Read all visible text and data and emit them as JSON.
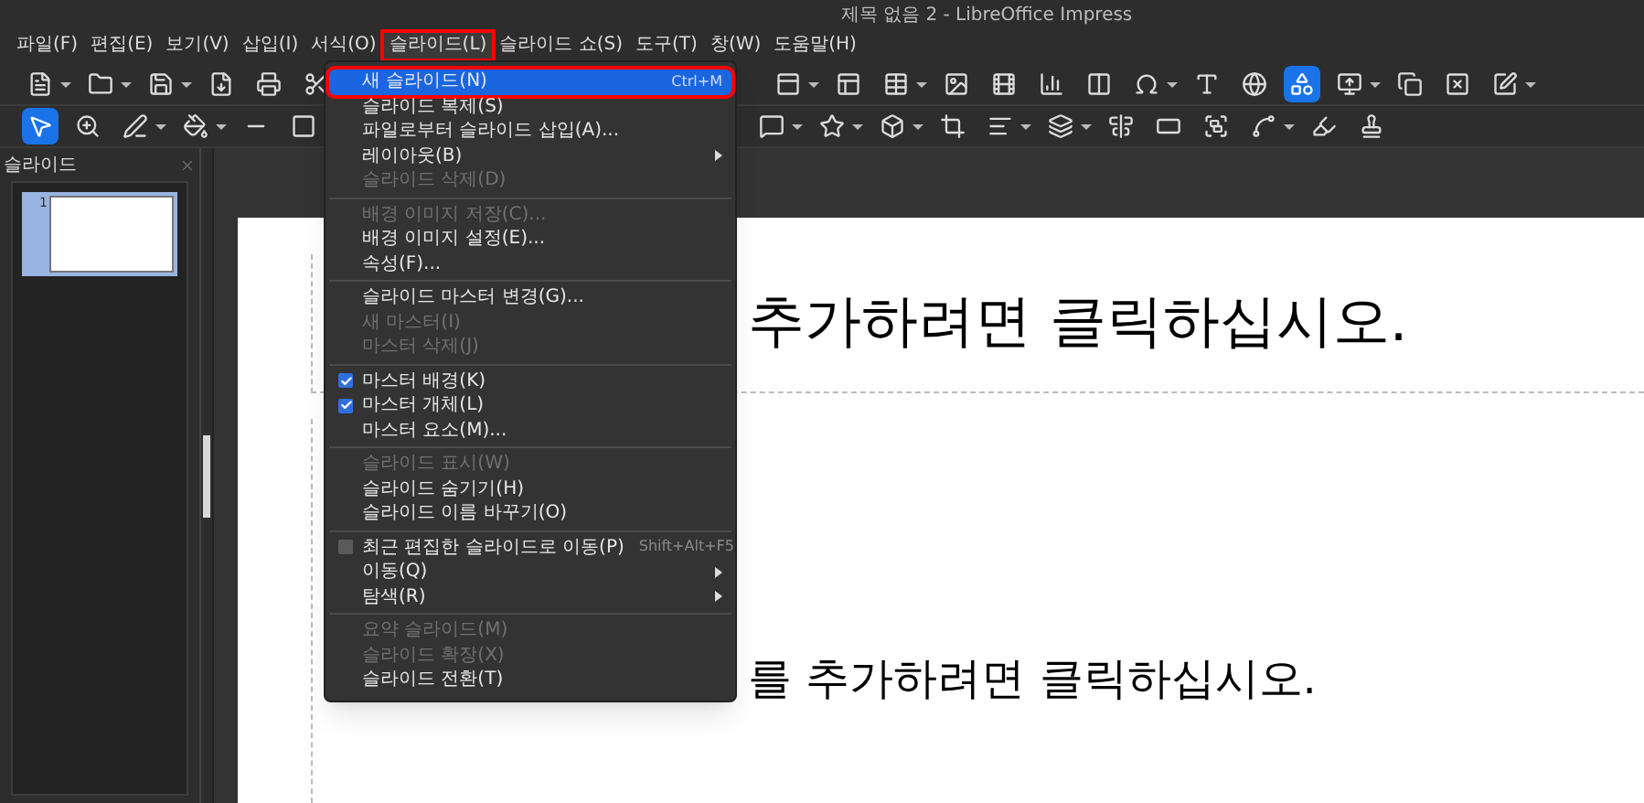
{
  "window": {
    "title": "제목 없음 2 - LibreOffice Impress"
  },
  "menubar": [
    {
      "label": "파일(F)",
      "selected": false
    },
    {
      "label": "편집(E)",
      "selected": false
    },
    {
      "label": "보기(V)",
      "selected": false
    },
    {
      "label": "삽입(I)",
      "selected": false
    },
    {
      "label": "서식(O)",
      "selected": false
    },
    {
      "label": "슬라이드(L)",
      "selected": true
    },
    {
      "label": "슬라이드 쇼(S)",
      "selected": false
    },
    {
      "label": "도구(T)",
      "selected": false
    },
    {
      "label": "창(W)",
      "selected": false
    },
    {
      "label": "도움말(H)",
      "selected": false
    }
  ],
  "slide_menu": [
    {
      "kind": "item",
      "label": "새 슬라이드(N)",
      "shortcut": "Ctrl+M",
      "selected": true,
      "disabled": false
    },
    {
      "kind": "item",
      "label": "슬라이드 복제(S)",
      "selected": false,
      "disabled": false
    },
    {
      "kind": "item",
      "label": "파일로부터 슬라이드 삽입(A)...",
      "selected": false,
      "disabled": false
    },
    {
      "kind": "submenu",
      "label": "레이아웃(B)",
      "selected": false,
      "disabled": false
    },
    {
      "kind": "item",
      "label": "슬라이드 삭제(D)",
      "selected": false,
      "disabled": true
    },
    {
      "kind": "separator"
    },
    {
      "kind": "item",
      "label": "배경 이미지 저장(C)...",
      "selected": false,
      "disabled": true
    },
    {
      "kind": "item",
      "label": "배경 이미지 설정(E)...",
      "selected": false,
      "disabled": false
    },
    {
      "kind": "item",
      "label": "속성(F)...",
      "selected": false,
      "disabled": false
    },
    {
      "kind": "separator"
    },
    {
      "kind": "item",
      "label": "슬라이드 마스터 변경(G)...",
      "selected": false,
      "disabled": false
    },
    {
      "kind": "item",
      "label": "새 마스터(I)",
      "selected": false,
      "disabled": true
    },
    {
      "kind": "item",
      "label": "마스터 삭제(J)",
      "selected": false,
      "disabled": true
    },
    {
      "kind": "separator"
    },
    {
      "kind": "check",
      "label": "마스터 배경(K)",
      "checked": true,
      "selected": false,
      "disabled": false
    },
    {
      "kind": "check",
      "label": "마스터 개체(L)",
      "checked": true,
      "selected": false,
      "disabled": false
    },
    {
      "kind": "item",
      "label": "마스터 요소(M)...",
      "selected": false,
      "disabled": false
    },
    {
      "kind": "separator"
    },
    {
      "kind": "item",
      "label": "슬라이드 표시(W)",
      "selected": false,
      "disabled": true
    },
    {
      "kind": "item",
      "label": "슬라이드 숨기기(H)",
      "selected": false,
      "disabled": false
    },
    {
      "kind": "item",
      "label": "슬라이드 이름 바꾸기(O)",
      "selected": false,
      "disabled": false
    },
    {
      "kind": "separator"
    },
    {
      "kind": "check",
      "label": "최근 편집한 슬라이드로 이동(P)",
      "shortcut": "Shift+Alt+F5",
      "checked": false,
      "selected": false,
      "disabled": false
    },
    {
      "kind": "submenu",
      "label": "이동(Q)",
      "selected": false,
      "disabled": false
    },
    {
      "kind": "submenu",
      "label": "탐색(R)",
      "selected": false,
      "disabled": false
    },
    {
      "kind": "separator"
    },
    {
      "kind": "item",
      "label": "요약 슬라이드(M)",
      "selected": false,
      "disabled": true
    },
    {
      "kind": "item",
      "label": "슬라이드 확장(X)",
      "selected": false,
      "disabled": true
    },
    {
      "kind": "item",
      "label": "슬라이드 전환(T)",
      "selected": false,
      "disabled": false
    }
  ],
  "slides_panel": {
    "title": "슬라이드",
    "slides": [
      {
        "number": "1",
        "selected": true
      }
    ]
  },
  "slide": {
    "title_placeholder": "추가하려면 클릭하십시오.",
    "text_placeholder": "를 추가하려면 클릭하십시오."
  }
}
